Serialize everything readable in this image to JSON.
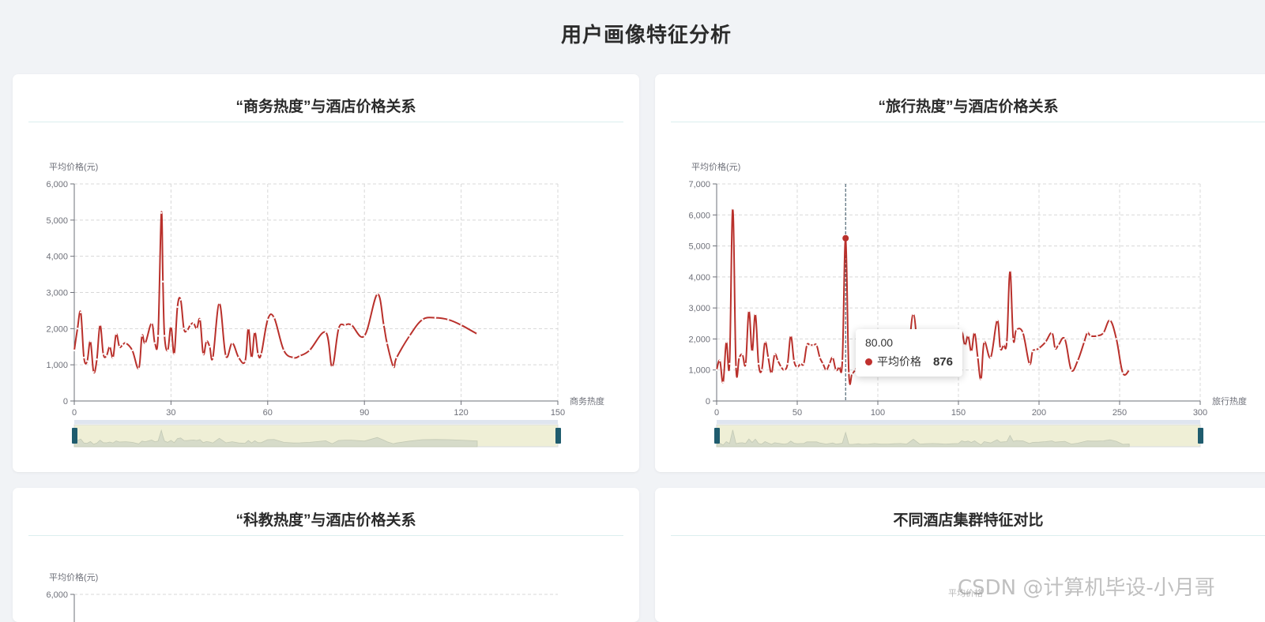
{
  "page": {
    "title": "用户画像特征分析"
  },
  "cards": [
    {
      "title": "“商务热度”与酒店价格关系"
    },
    {
      "title": "“旅行热度”与酒店价格关系"
    },
    {
      "title": "“科教热度”与酒店价格关系"
    },
    {
      "title": "不同酒店集群特征对比"
    }
  ],
  "tooltip": {
    "x": "80.00",
    "series": "平均价格",
    "value": "876"
  },
  "watermark": "CSDN @计算机毕设-小月哥",
  "ghost_label": "平均价格",
  "colors": {
    "line": "#b9302b",
    "grid": "#d8d8d8",
    "axis": "#6e7079",
    "slider_handle": "#1f5c6e",
    "slider_fill": "#efefd6",
    "slider_area": "#d6dbc9"
  },
  "chart_data": [
    {
      "type": "line",
      "title": "“商务热度”与酒店价格关系",
      "xlabel": "商务热度",
      "ylabel": "平均价格(元)",
      "xlim": [
        0,
        150
      ],
      "ylim": [
        0,
        6000
      ],
      "xticks": [
        0,
        30,
        60,
        90,
        120,
        150
      ],
      "yticks": [
        0,
        1000,
        2000,
        3000,
        4000,
        5000,
        6000
      ],
      "grid": true,
      "smooth": true,
      "series": [
        {
          "name": "平均价格",
          "x": [
            0,
            1,
            2,
            3,
            4,
            5,
            6,
            7,
            8,
            9,
            10,
            11,
            12,
            13,
            14,
            15,
            16,
            18,
            20,
            21,
            22,
            24,
            25,
            26,
            27,
            27.5,
            28,
            29,
            30,
            31,
            32,
            33,
            34,
            35,
            36,
            37,
            38,
            39,
            40,
            41,
            42,
            43,
            45,
            47,
            49,
            51,
            53,
            54,
            55,
            56,
            57,
            58,
            60,
            62,
            65,
            68,
            70,
            73,
            78,
            80,
            82,
            84,
            86,
            90,
            94,
            96,
            97,
            99,
            100,
            104,
            108,
            112,
            116,
            120,
            125
          ],
          "values": [
            1400,
            2000,
            2450,
            1200,
            1100,
            1650,
            800,
            1150,
            2100,
            1300,
            1250,
            1500,
            1200,
            1850,
            1500,
            1550,
            1600,
            1400,
            900,
            1800,
            1600,
            2150,
            1600,
            1800,
            5200,
            3300,
            1800,
            1400,
            2050,
            1300,
            2600,
            2800,
            2000,
            1950,
            2100,
            2150,
            2000,
            2250,
            1300,
            1650,
            1500,
            1200,
            2700,
            1250,
            1600,
            1200,
            1100,
            2000,
            1200,
            1900,
            1300,
            1300,
            2250,
            2300,
            1400,
            1200,
            1250,
            1400,
            1900,
            950,
            2000,
            2100,
            2100,
            1800,
            2950,
            2100,
            1600,
            950,
            1200,
            1800,
            2250,
            2300,
            2250,
            2100,
            1850
          ]
        }
      ]
    },
    {
      "type": "line",
      "title": "“旅行热度”与酒店价格关系",
      "xlabel": "旅行热度",
      "ylabel": "平均价格(元)",
      "xlim": [
        0,
        300
      ],
      "ylim": [
        0,
        7000
      ],
      "xticks": [
        0,
        50,
        100,
        150,
        200,
        250,
        300
      ],
      "yticks": [
        0,
        1000,
        2000,
        3000,
        4000,
        5000,
        6000,
        7000
      ],
      "grid": true,
      "smooth": true,
      "highlight_x": 80,
      "series": [
        {
          "name": "平均价格",
          "x": [
            0,
            2,
            4,
            6,
            8,
            10,
            12,
            14,
            16,
            18,
            20,
            22,
            24,
            26,
            28,
            30,
            32,
            34,
            36,
            38,
            40,
            42,
            44,
            46,
            48,
            50,
            52,
            54,
            56,
            58,
            60,
            62,
            64,
            66,
            68,
            70,
            72,
            74,
            76,
            78,
            80,
            82,
            84,
            86,
            88,
            90,
            94,
            98,
            102,
            106,
            110,
            114,
            118,
            122,
            126,
            130,
            134,
            138,
            142,
            146,
            150,
            152,
            154,
            156,
            158,
            160,
            162,
            164,
            166,
            170,
            174,
            176,
            178,
            180,
            182,
            184,
            186,
            190,
            194,
            196,
            198,
            200,
            204,
            208,
            210,
            212,
            216,
            220,
            224,
            228,
            230,
            232,
            236,
            240,
            244,
            248,
            252,
            256
          ],
          "values": [
            1000,
            1300,
            600,
            1900,
            1200,
            6200,
            1100,
            1400,
            1500,
            1200,
            2900,
            1600,
            2800,
            1200,
            1000,
            1900,
            1400,
            900,
            1500,
            1300,
            1100,
            1000,
            1200,
            2100,
            1300,
            1100,
            1200,
            1200,
            1800,
            1800,
            1800,
            1800,
            1400,
            1200,
            1000,
            1200,
            1400,
            1000,
            1100,
            1300,
            5250,
            900,
            876,
            1000,
            1100,
            900,
            1000,
            1200,
            950,
            1000,
            1100,
            1200,
            1000,
            2800,
            1000,
            1100,
            1200,
            1100,
            1000,
            1100,
            1200,
            2200,
            1800,
            2100,
            1600,
            2200,
            1400,
            700,
            1900,
            1400,
            2600,
            1700,
            1800,
            1900,
            4200,
            2000,
            2300,
            2200,
            1200,
            1600,
            1650,
            1700,
            1900,
            2200,
            1700,
            1800,
            2000,
            1000,
            1300,
            1900,
            2200,
            2100,
            2100,
            2200,
            2600,
            2000,
            900,
            1000
          ]
        }
      ]
    },
    {
      "type": "line",
      "title": "“科教热度”与酒店价格关系",
      "ylabel": "平均价格(元)",
      "yticks": [
        6000
      ],
      "grid": true,
      "series": []
    }
  ]
}
